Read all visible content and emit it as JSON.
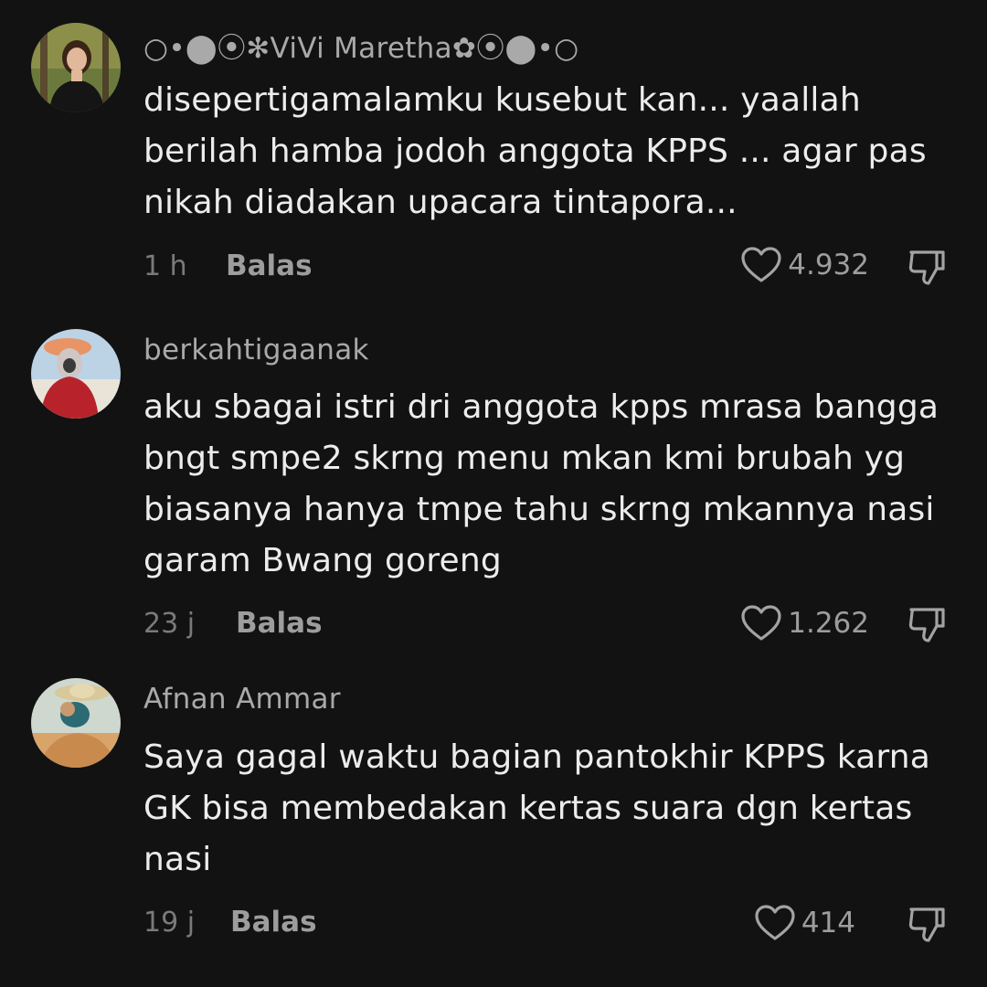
{
  "comments": [
    {
      "username": "○•⬤⦿✻ViVi Maretha✿⦿⬤•○",
      "text": "disepertigamalamku kusebut kan... yaallah berilah hamba jodoh anggota KPPS ... agar pas nikah diadakan upacara tintapora...",
      "time": "1 h",
      "reply_label": "Balas",
      "likes": "4.932"
    },
    {
      "username": "berkahtigaanak",
      "text": "aku sbagai istri dri anggota kpps mrasa bangga bngt smpe2 skrng menu mkan kmi brubah yg biasanya hanya tmpe tahu skrng mkannya nasi garam Bwang goreng",
      "time": "23 j",
      "reply_label": "Balas",
      "likes": "1.262"
    },
    {
      "username": "Afnan Ammar",
      "text": "Saya gagal waktu bagian pantokhir KPPS karna GK bisa membedakan kertas suara dgn kertas nasi",
      "time": "19 j",
      "reply_label": "Balas",
      "likes": "414"
    }
  ],
  "icons": {
    "like": "heart-outline-icon",
    "dislike": "thumbs-down-icon"
  },
  "colors": {
    "background": "#121212",
    "text": "#ececec",
    "username": "#a9a9a9",
    "meta": "#7a7a7a"
  }
}
